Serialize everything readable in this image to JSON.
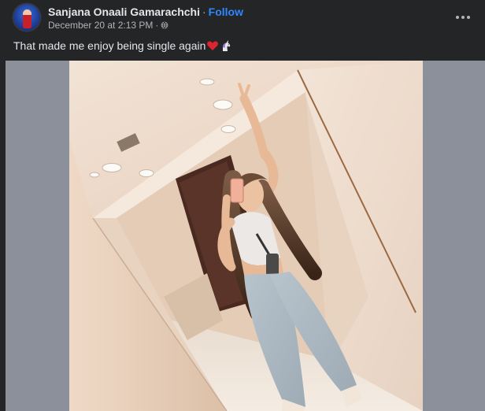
{
  "post": {
    "author": {
      "name": "Sanjana Onaali Gamarachchi",
      "separator": "·",
      "follow_label": "Follow",
      "avatar_icon": "profile-avatar"
    },
    "meta": {
      "timestamp": "December 20 at 2:13 PM",
      "separator": "·",
      "audience_icon": "globe-icon"
    },
    "caption": {
      "text": "That made me enjoy being single again",
      "emojis": [
        "red-heart-emoji",
        "unicorn-emoji"
      ]
    },
    "menu_icon": "more-options-icon",
    "photo": {
      "subject": "mirror-selfie-photo"
    }
  },
  "colors": {
    "background": "#242526",
    "primary_text": "#e4e6eb",
    "secondary_text": "#b0b3b8",
    "link": "#2d88ff",
    "media_backdrop": "#8b909a"
  }
}
